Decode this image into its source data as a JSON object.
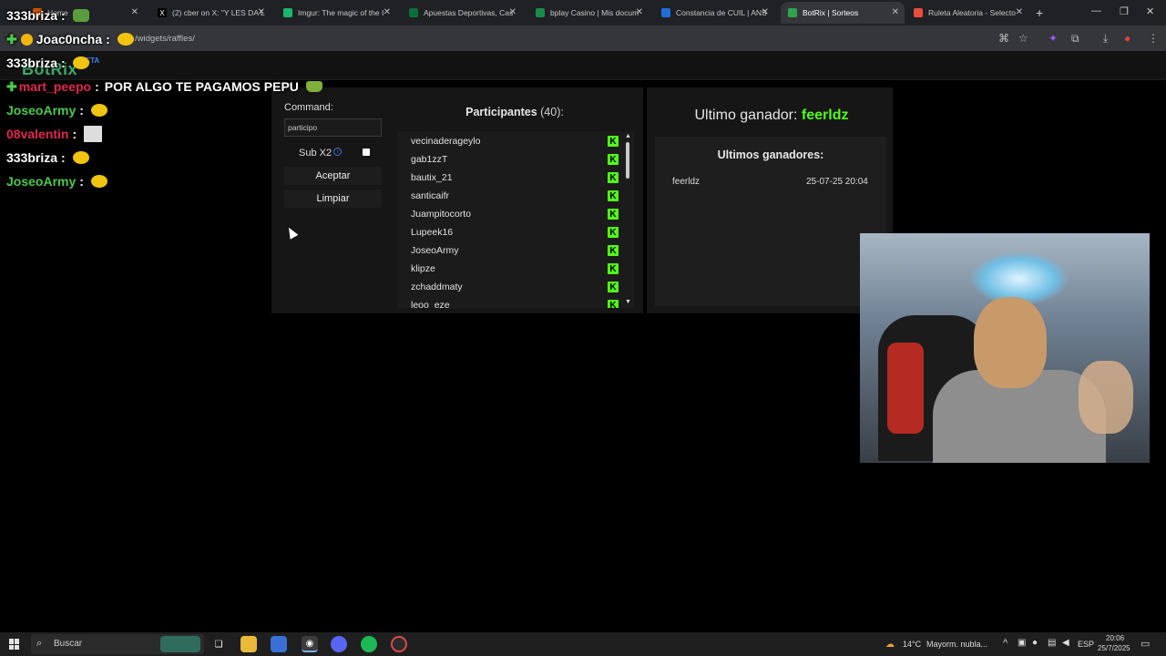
{
  "browser": {
    "tabs": [
      {
        "title": "Home",
        "color": "#d35400"
      },
      {
        "title": "(2) cber on X: \"Y LES DA L",
        "color": "#000000"
      },
      {
        "title": "Imgur: The magic of the I",
        "color": "#1bb76e"
      },
      {
        "title": "Apuestas Deportivas, Cas",
        "color": "#0b6e3a"
      },
      {
        "title": "bplay Casino | Mis docum",
        "color": "#1a8a4a"
      },
      {
        "title": "Constancia de CUIL | ANS",
        "color": "#1f6fd6"
      },
      {
        "title": "BotRix | Sorteos",
        "color": "#2ea44f"
      },
      {
        "title": "Ruleta Aleatoria - Selecto",
        "color": "#e84d3d"
      }
    ],
    "url": "/widgets/raffles/"
  },
  "app": {
    "logo": "BotRix",
    "badge": "BETA"
  },
  "raffle": {
    "command_label": "Command:",
    "command_value": "participo",
    "sub_x2_label": "Sub X2",
    "accept_label": "Aceptar",
    "clear_label": "Limpiar",
    "participants_label": "Participantes",
    "participants_count": "(40):",
    "participants": [
      "vecinaderageylo",
      "gab1zzT",
      "bautix_21",
      "santicaifr",
      "Juampitocorto",
      "Lupeek16",
      "JoseoArmy",
      "klipze",
      "zchaddmaty",
      "leoo_eze"
    ],
    "last_winner_label": "Ultimo ganador:",
    "last_winner_name": "feerldz",
    "winners_title": "Ultimos ganadores:",
    "winners": [
      {
        "name": "feerldz",
        "date": "25-07-25 20:04"
      }
    ]
  },
  "chat": [
    {
      "user": "333briza",
      "color": "#ffffff",
      "message": "",
      "top": 0
    },
    {
      "user": "Joac0ncha",
      "color": "#ffffff",
      "message": "",
      "top": 0
    },
    {
      "user": "333briza",
      "color": "#ffffff",
      "message": "",
      "top": 0
    },
    {
      "user": "mart_peepo",
      "color": "#e0284f",
      "message": "POR ALGO TE PAGAMOS PEPU",
      "top": 0
    },
    {
      "user": "JoseoArmy",
      "color": "#4cc94c",
      "message": "",
      "top": 0
    },
    {
      "user": "08valentin",
      "color": "#e0284f",
      "message": "",
      "top": 0
    },
    {
      "user": "333briza",
      "color": "#ffffff",
      "message": "",
      "top": 0
    },
    {
      "user": "JoseoArmy",
      "color": "#4cc94c",
      "message": "",
      "top": 0
    }
  ],
  "taskbar": {
    "search_placeholder": "Buscar",
    "weather_temp": "14°C",
    "weather_text": "Mayorm. nubla...",
    "language": "ESP",
    "time": "20:06",
    "date": "25/7/2025"
  }
}
